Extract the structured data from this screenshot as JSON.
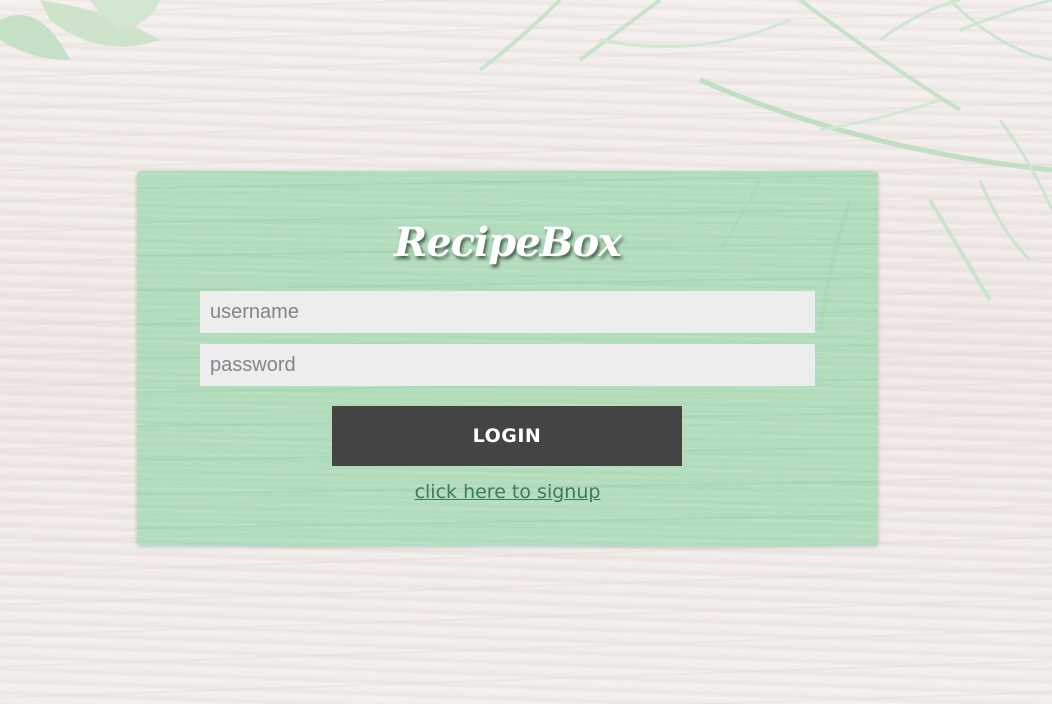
{
  "app": {
    "brand": "RecipeBox"
  },
  "login_form": {
    "username": {
      "placeholder": "username",
      "value": ""
    },
    "password": {
      "placeholder": "password",
      "value": ""
    },
    "login_label": "LOGIN",
    "signup_link_text": "click here to signup"
  },
  "colors": {
    "card_background": "#96d6a8",
    "input_background": "#ededed",
    "button_background": "#444444",
    "button_text": "#ffffff",
    "link": "#3f7a5a",
    "page_background": "#efe9e6"
  },
  "decorations": {
    "background_icon": "herb-leaves-icon"
  }
}
